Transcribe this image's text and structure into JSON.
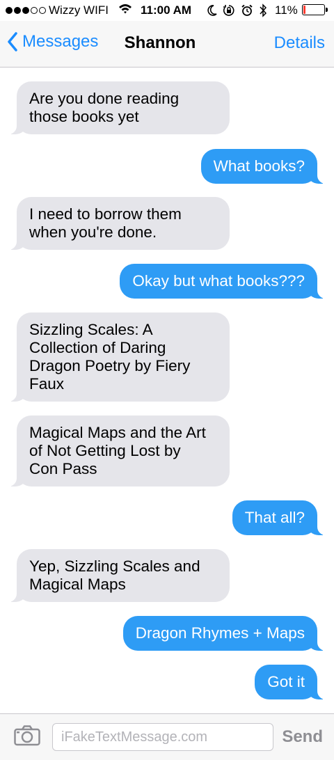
{
  "status_bar": {
    "signal_bars_filled": 3,
    "signal_bars_total": 5,
    "carrier": "Wizzy WIFI",
    "time": "11:00 AM",
    "battery_percent": "11%",
    "battery_level": 0.11,
    "icons": [
      "wifi-icon",
      "moon-icon",
      "orientation-lock-icon",
      "alarm-icon",
      "bluetooth-icon",
      "battery-icon"
    ],
    "battery_color": "#ff3b30"
  },
  "nav": {
    "back_label": "Messages",
    "title": "Shannon",
    "details_label": "Details",
    "accent_color": "#1a8cff"
  },
  "messages": [
    {
      "direction": "in",
      "text": "Are you done reading\nthose books yet"
    },
    {
      "direction": "out",
      "text": "What books?"
    },
    {
      "direction": "in",
      "text": "I need to borrow them\nwhen you're done."
    },
    {
      "direction": "out",
      "text": "Okay but what books???"
    },
    {
      "direction": "in",
      "text": "Sizzling Scales: A\nCollection of Daring\nDragon Poetry by Fiery\nFaux"
    },
    {
      "direction": "in",
      "text": "Magical Maps and the Art\nof Not Getting Lost by\nCon Pass"
    },
    {
      "direction": "out",
      "text": "That all?"
    },
    {
      "direction": "in",
      "text": "Yep, Sizzling Scales and\nMagical Maps"
    },
    {
      "direction": "out",
      "text": "Dragon Rhymes + Maps"
    },
    {
      "direction": "out",
      "text": "Got it"
    }
  ],
  "input_bar": {
    "camera_icon": "camera-icon",
    "placeholder": "iFakeTextMessage.com",
    "send_label": "Send"
  },
  "colors": {
    "incoming_bubble": "#e5e5ea",
    "outgoing_bubble": "#2e9cf5"
  }
}
